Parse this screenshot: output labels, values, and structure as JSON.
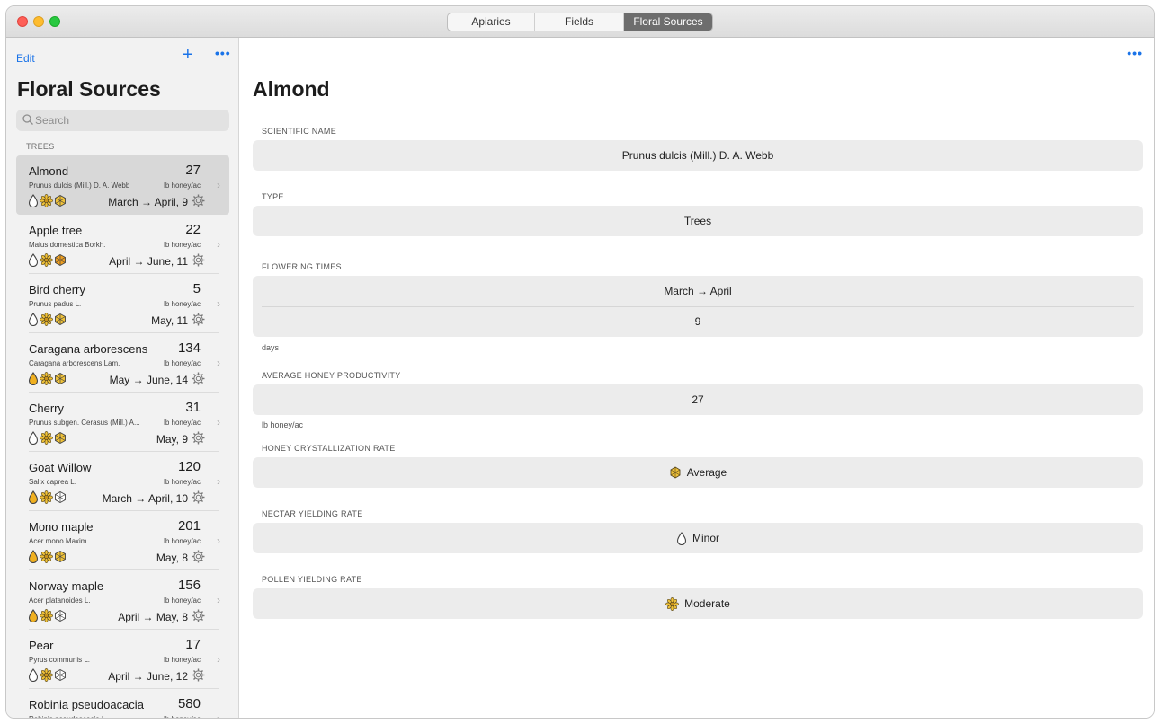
{
  "tabs": [
    {
      "label": "Apiaries",
      "active": false
    },
    {
      "label": "Fields",
      "active": false
    },
    {
      "label": "Floral Sources",
      "active": true
    }
  ],
  "sidebar": {
    "edit_label": "Edit",
    "add_icon": "plus-icon",
    "more_icon": "ellipsis-icon",
    "title": "Floral Sources",
    "search_placeholder": "Search",
    "section": "TREES",
    "unit": "lb honey/ac",
    "items": [
      {
        "name": "Almond",
        "count": "27",
        "scientific": "Prunus dulcis (Mill.) D. A. Webb",
        "period": "March → April, 9",
        "nectar": "#ffffff",
        "pollen": "#f0c238",
        "crystal": "#f0c238"
      },
      {
        "name": "Apple tree",
        "count": "22",
        "scientific": "Malus domestica Borkh.",
        "period": "April → June, 11",
        "nectar": "#ffffff",
        "pollen": "#f0c238",
        "crystal": "#f0a020"
      },
      {
        "name": "Bird cherry",
        "count": "5",
        "scientific": "Prunus padus L.",
        "period": "May, 11",
        "nectar": "#ffffff",
        "pollen": "#f0c238",
        "crystal": "#f0c238"
      },
      {
        "name": "Caragana arborescens",
        "count": "134",
        "scientific": "Caragana arborescens Lam.",
        "period": "May → June, 14",
        "nectar": "#f0b020",
        "pollen": "#f0c238",
        "crystal": "#f0c238"
      },
      {
        "name": "Cherry",
        "count": "31",
        "scientific": "Prunus subgen. Cerasus (Mill.) A...",
        "period": "May, 9",
        "nectar": "#ffffff",
        "pollen": "#f0c238",
        "crystal": "#f0c238"
      },
      {
        "name": "Goat Willow",
        "count": "120",
        "scientific": "Salix caprea L.",
        "period": "March → April, 10",
        "nectar": "#f0b020",
        "pollen": "#f0c238",
        "crystal": "#ffffff"
      },
      {
        "name": "Mono maple",
        "count": "201",
        "scientific": "Acer mono Maxim.",
        "period": "May, 8",
        "nectar": "#f0b020",
        "pollen": "#f0c238",
        "crystal": "#f0c238"
      },
      {
        "name": "Norway maple",
        "count": "156",
        "scientific": "Acer platanoides L.",
        "period": "April → May, 8",
        "nectar": "#f0b020",
        "pollen": "#f0c238",
        "crystal": "#ffffff"
      },
      {
        "name": "Pear",
        "count": "17",
        "scientific": "Pyrus communis L.",
        "period": "April → June, 12",
        "nectar": "#ffffff",
        "pollen": "#f0c238",
        "crystal": "#ffffff"
      },
      {
        "name": "Robinia pseudoacacia",
        "count": "580",
        "scientific": "Robinia pseudoacacia L.",
        "period": "",
        "nectar": "#f0b020",
        "pollen": "#f0c238",
        "crystal": "#ffffff"
      }
    ]
  },
  "detail": {
    "more_icon": "ellipsis-icon",
    "title": "Almond",
    "scientific_label": "SCIENTIFIC NAME",
    "scientific_value": "Prunus dulcis (Mill.) D. A. Webb",
    "type_label": "TYPE",
    "type_value": "Trees",
    "flowering_label": "FLOWERING TIMES",
    "flowering_period": "March → April",
    "flowering_days": "9",
    "flowering_foot": "days",
    "productivity_label": "AVERAGE HONEY PRODUCTIVITY",
    "productivity_value": "27",
    "productivity_foot": "lb honey/ac",
    "crystallization_label": "HONEY CRYSTALLIZATION RATE",
    "crystallization_value": "Average",
    "nectar_label": "NECTAR YIELDING RATE",
    "nectar_value": "Minor",
    "pollen_label": "POLLEN YIELDING RATE",
    "pollen_value": "Moderate"
  },
  "colors": {
    "accent": "#1a73e8",
    "honey": "#f0c238",
    "active_tab": "#6d6d6d"
  }
}
